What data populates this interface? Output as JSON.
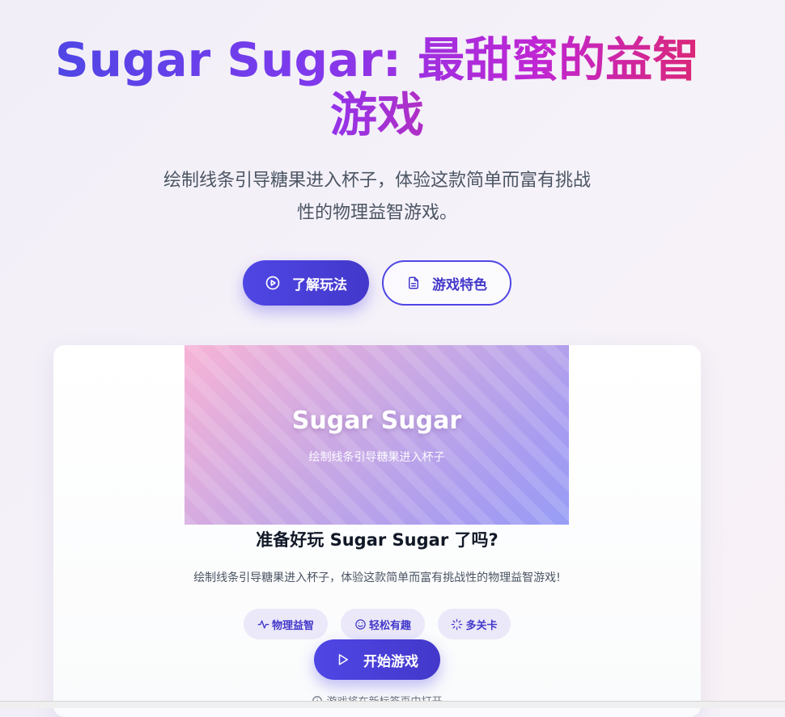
{
  "hero": {
    "title_part1": "Sugar Sugar: 最甜蜜的益智",
    "title_part2": "游戏",
    "subtitle_line1": "绘制线条引导糖果进入杯子，体验这款简单而富有挑战",
    "subtitle_line2": "性的物理益智游戏。"
  },
  "buttons": {
    "learn_label": "了解玩法",
    "features_label": "游戏特色",
    "start_label": "开始游戏"
  },
  "game_card": {
    "banner_title": "Sugar Sugar",
    "banner_subtitle": "绘制线条引导糖果进入杯子",
    "ready_title": "准备好玩 Sugar Sugar 了吗?",
    "description": "绘制线条引导糖果进入杯子，体验这款简单而富有挑战性的物理益智游戏!",
    "tags": [
      {
        "label": "物理益智",
        "icon": "activity-icon"
      },
      {
        "label": "轻松有趣",
        "icon": "smile-icon"
      },
      {
        "label": "多关卡",
        "icon": "loader-icon"
      }
    ],
    "note": "游戏将在新标签页中打开"
  },
  "colors": {
    "primary": "#4f46e5",
    "primary_dark": "#4338ca",
    "accent_pink": "#db2777",
    "accent_purple": "#9333ea",
    "tag_bg": "#ebe8f9"
  }
}
